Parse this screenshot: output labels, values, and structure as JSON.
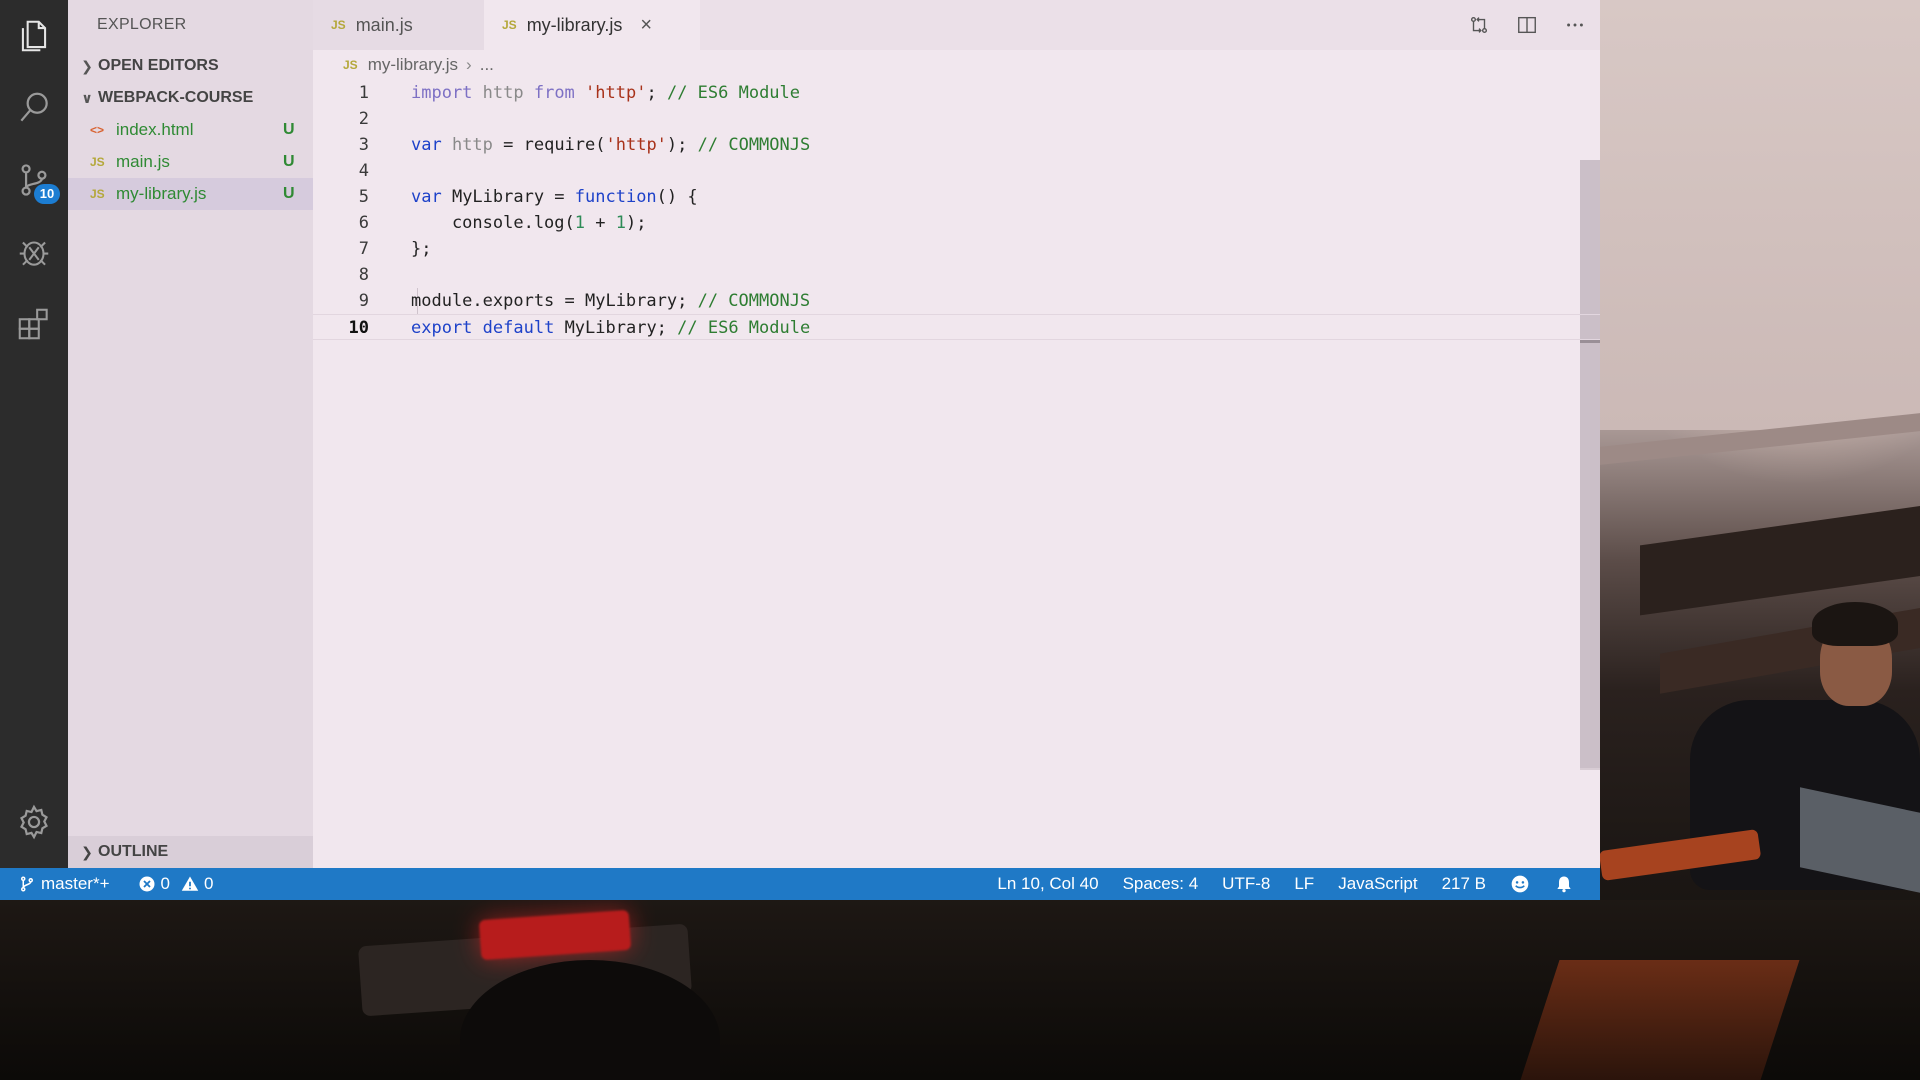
{
  "sidebar": {
    "title": "EXPLORER",
    "open_editors": "OPEN EDITORS",
    "project": "WEBPACK-COURSE",
    "files": [
      {
        "icon": "<>",
        "name": "index.html",
        "status": "U"
      },
      {
        "icon": "JS",
        "name": "main.js",
        "status": "U"
      },
      {
        "icon": "JS",
        "name": "my-library.js",
        "status": "U"
      }
    ],
    "outline": "OUTLINE"
  },
  "activity": {
    "scm_badge": "10"
  },
  "tabs": [
    {
      "icon": "JS",
      "label": "main.js"
    },
    {
      "icon": "JS",
      "label": "my-library.js",
      "close": "×"
    }
  ],
  "breadcrumb": {
    "icon": "JS",
    "file": "my-library.js",
    "rest": "..."
  },
  "code": {
    "line_numbers": [
      "1",
      "2",
      "3",
      "4",
      "5",
      "6",
      "7",
      "8",
      "9",
      "10"
    ],
    "lines": [
      [
        {
          "t": "import",
          "c": "kw2"
        },
        {
          "t": " http ",
          "c": "idf"
        },
        {
          "t": "from",
          "c": "kw2"
        },
        {
          "t": " ",
          "c": ""
        },
        {
          "t": "'http'",
          "c": "str"
        },
        {
          "t": "; ",
          "c": ""
        },
        {
          "t": "// ES6 Module",
          "c": "cm"
        }
      ],
      [],
      [
        {
          "t": "var",
          "c": "kw"
        },
        {
          "t": " http ",
          "c": "idf"
        },
        {
          "t": "= require(",
          "c": ""
        },
        {
          "t": "'http'",
          "c": "str"
        },
        {
          "t": "); ",
          "c": ""
        },
        {
          "t": "// COMMONJS",
          "c": "cm"
        }
      ],
      [],
      [
        {
          "t": "var",
          "c": "kw"
        },
        {
          "t": " MyLibrary = ",
          "c": ""
        },
        {
          "t": "function",
          "c": "kw"
        },
        {
          "t": "() {",
          "c": ""
        }
      ],
      [
        {
          "t": "    console.log(",
          "c": ""
        },
        {
          "t": "1",
          "c": "num"
        },
        {
          "t": " + ",
          "c": ""
        },
        {
          "t": "1",
          "c": "num"
        },
        {
          "t": ");",
          "c": ""
        }
      ],
      [
        {
          "t": "};",
          "c": ""
        }
      ],
      [],
      [
        {
          "t": "module.exports = MyLibrary; ",
          "c": ""
        },
        {
          "t": "// COMMONJS",
          "c": "cm"
        }
      ],
      [
        {
          "t": "export",
          "c": "kw"
        },
        {
          "t": " ",
          "c": ""
        },
        {
          "t": "default",
          "c": "kw"
        },
        {
          "t": " MyLibrary; ",
          "c": ""
        },
        {
          "t": "// ES6 Module",
          "c": "cm"
        }
      ]
    ]
  },
  "status": {
    "branch": "master*+",
    "errors": "0",
    "warnings": "0",
    "position": "Ln 10, Col 40",
    "spaces": "Spaces: 4",
    "encoding": "UTF-8",
    "eol": "LF",
    "language": "JavaScript",
    "size": "217 B"
  },
  "colors": {
    "status_bar": "#1f79c6",
    "activity_bar": "#2c2c2c",
    "keyword": "#1e42c9",
    "string": "#a8321a",
    "comment": "#2e7d32",
    "untracked": "#2f8a34"
  }
}
